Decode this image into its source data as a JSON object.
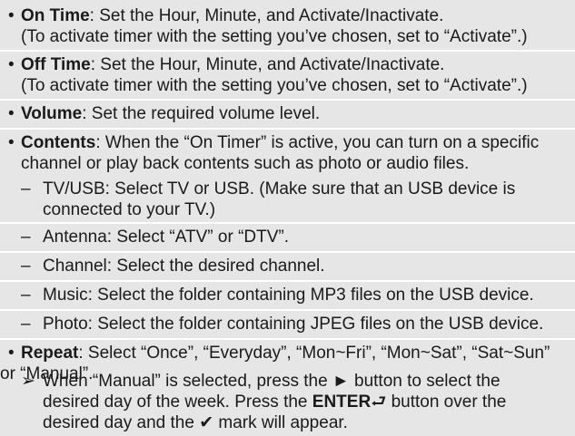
{
  "items": [
    {
      "term": "On Time",
      "text": ": Set the Hour, Minute, and Activate/Inactivate.",
      "cont": "(To activate timer with the setting you’ve chosen, set to “Activate”.)"
    },
    {
      "term": "Off Time",
      "text": ": Set the Hour, Minute, and Activate/Inactivate.",
      "cont": "(To activate timer with the setting you’ve chosen, set to “Activate”.)"
    },
    {
      "term": "Volume",
      "text": ": Set the required volume level."
    },
    {
      "term": "Contents",
      "text": ": When the “On Timer” is active, you can turn on a specific",
      "cont": "channel or play back contents such as photo or audio files.",
      "subitems": [
        {
          "line1": "TV/USB: Select TV or USB. (Make sure that an USB device is",
          "line2": "connected to your TV.)"
        },
        {
          "line1": "Antenna: Select “ATV” or “DTV”."
        },
        {
          "line1": "Channel: Select the desired channel."
        },
        {
          "line1": "Music: Select the folder containing MP3 files on the USB device."
        },
        {
          "line1": "Photo: Select the folder containing JPEG files on the USB device."
        }
      ]
    },
    {
      "term": "Repeat",
      "text": ": Select “Once”, “Everyday”, “Mon~Fri”, “Mon~Sat”, “Sat~Sun”",
      "cont": "or “Manual”.",
      "note": {
        "marker": "➢",
        "line1": "When “Manual” is selected, press the ► button to select the",
        "line2_pre": "desired day of the week. Press the ",
        "line2_bold": "ENTER",
        "line2_icon": "⮐",
        "line2_post": " button over the",
        "line3_pre": "desired day and the ",
        "line3_icon": "✔",
        "line3_post": " mark will appear."
      }
    }
  ],
  "bullet_char": "•",
  "dash_char": "–"
}
